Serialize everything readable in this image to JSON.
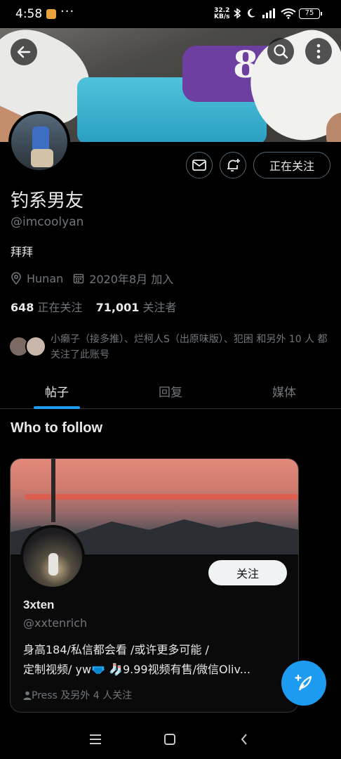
{
  "status_bar": {
    "time": "4:58",
    "dots": "···",
    "speed_value": "32.2",
    "speed_unit": "KB/s",
    "battery": "75"
  },
  "profile": {
    "name": "钓系男友",
    "handle": "@imcoolyan",
    "bio": "拜拜",
    "location": "Hunan",
    "joined": "2020年8月 加入",
    "following_count": "648",
    "following_label": "正在关注",
    "followers_count": "71,001",
    "followers_label": "关注者",
    "following_button": "正在关注",
    "followed_by_text": "小癞子（接多推）、烂柯人S（出原味版）、犯困 和另外 10 人 都关注了此账号",
    "banner_number": "8"
  },
  "tabs": [
    {
      "label": "帖子",
      "active": true
    },
    {
      "label": "回复",
      "active": false
    },
    {
      "label": "媒体",
      "active": false
    }
  ],
  "who_to_follow": {
    "heading": "Who to follow",
    "card": {
      "name": "3xten",
      "handle": "@xxtenrich",
      "follow_button": "关注",
      "bio_line1": "身高184/私信都会看 /或许更多可能 /",
      "bio_line2": "定制视频/ yw🩲 🧦9.99视频有售/微信Oliv...",
      "followed_by": "Press 及另外 4 人关注"
    }
  },
  "colors": {
    "accent": "#1d9bf0",
    "background": "#000000",
    "text_primary": "#e7e9ea",
    "text_secondary": "#71767b"
  }
}
